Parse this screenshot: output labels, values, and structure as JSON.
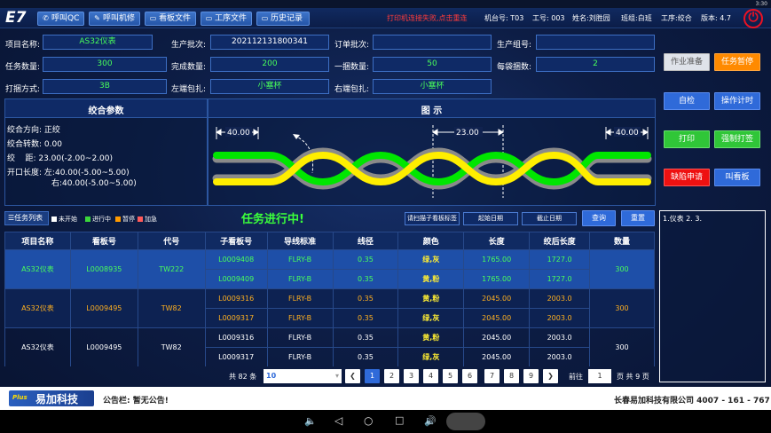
{
  "status_bar": {
    "time": "3:30"
  },
  "app": {
    "logo": "E7"
  },
  "nav": [
    {
      "label": "呼叫QC",
      "icon": "phone-icon"
    },
    {
      "label": "呼叫机修",
      "icon": "wrench-icon"
    },
    {
      "label": "看板文件",
      "icon": "folder-icon"
    },
    {
      "label": "工序文件",
      "icon": "folder-icon"
    },
    {
      "label": "历史记录",
      "icon": "folder-icon"
    }
  ],
  "header": {
    "warning": "打印机连接失败,点击重连",
    "machine_label": "机台号:",
    "machine": "T03",
    "worker_label": "工号:",
    "worker": "003",
    "name_label": "姓名:",
    "name": "刘胜园",
    "team_label": "班组:",
    "team": "白班",
    "process_label": "工序:",
    "process": "绞合",
    "version_label": "版本:",
    "version": "4.7"
  },
  "form": {
    "project_name_label": "项目名称:",
    "project_name": "AS32仪表",
    "prod_batch_label": "生产批次:",
    "prod_batch": "202112131800341",
    "order_batch_label": "订单批次:",
    "order_batch": "",
    "prod_group_label": "生产组号:",
    "prod_group": "",
    "task_qty_label": "任务数量:",
    "task_qty": "300",
    "done_qty_label": "完成数量:",
    "done_qty": "200",
    "bundle_qty_label": "一捆数量:",
    "bundle_qty": "50",
    "per_bag_label": "每袋捆数:",
    "per_bag": "2",
    "bind_mode_label": "打捆方式:",
    "bind_mode": "3B",
    "left_wrap_label": "左端包扎:",
    "left_wrap": "小塞杯",
    "right_wrap_label": "右端包扎:",
    "right_wrap": "小塞杯"
  },
  "actions": {
    "prepare": "作业准备",
    "pause": "任务暂停",
    "self_check": "自检",
    "op_timer": "操作计时",
    "print": "打印",
    "force_print": "强制打签",
    "defect": "缺陷申请",
    "call_board": "叫看板"
  },
  "twist_params": {
    "title": "绞合参数",
    "direction_label": "绞合方向:",
    "direction": "正绞",
    "turns_label": "绞合转数:",
    "turns": "0.00",
    "pitch_label": "绞    距:",
    "pitch": "23.00(-2.00~2.00)",
    "open_label": "开口长度:",
    "open_left_label": "左:",
    "open_left": "40.00(-5.00~5.00)",
    "open_right_label": "右:",
    "open_right": "40.00(-5.00~5.00)"
  },
  "diagram": {
    "title": "图 示",
    "left_dim": "40.00",
    "mid_dim": "23.00",
    "right_dim": "40.00",
    "colors": {
      "yellow": "#ffee00",
      "green": "#00e600",
      "gray": "#8a8a8a"
    }
  },
  "tasks": {
    "tab_label": "任务列表",
    "legend": [
      {
        "label": "未开始",
        "color": "#ffffff"
      },
      {
        "label": "进行中",
        "color": "#3bd63b"
      },
      {
        "label": "暂停",
        "color": "#ff9a00"
      },
      {
        "label": "加急",
        "color": "#ff5a5a"
      }
    ],
    "status": "任务进行中!",
    "scan_btn": "请扫描子看板标签",
    "start_date": "起始日期",
    "end_date": "截止日期",
    "query": "查询",
    "reset": "重置",
    "note": "1.仪表 2. 3.",
    "columns": [
      "项目名称",
      "看板号",
      "代号",
      "子看板号",
      "导线标准",
      "线径",
      "颜色",
      "长度",
      "绞后长度",
      "数量"
    ],
    "groups": [
      {
        "project": "AS32仪表",
        "board": "L0008935",
        "code": "TW222",
        "qty": "300",
        "style": "sel",
        "rows": [
          {
            "sub": "L0009408",
            "std": "FLRY-B",
            "dia": "0.35",
            "color": "绿,灰",
            "len": "1765.00",
            "after": "1727.0"
          },
          {
            "sub": "L0009409",
            "std": "FLRY-B",
            "dia": "0.35",
            "color": "黄,粉",
            "len": "1765.00",
            "after": "1727.0"
          }
        ]
      },
      {
        "project": "AS32仪表",
        "board": "L0009495",
        "code": "TW82",
        "qty": "300",
        "style": "orange",
        "rows": [
          {
            "sub": "L0009316",
            "std": "FLRY-B",
            "dia": "0.35",
            "color": "黄,粉",
            "len": "2045.00",
            "after": "2003.0"
          },
          {
            "sub": "L0009317",
            "std": "FLRY-B",
            "dia": "0.35",
            "color": "绿,灰",
            "len": "2045.00",
            "after": "2003.0"
          }
        ]
      },
      {
        "project": "AS32仪表",
        "board": "L0009495",
        "code": "TW82",
        "qty": "300",
        "style": "white",
        "rows": [
          {
            "sub": "L0009316",
            "std": "FLRY-B",
            "dia": "0.35",
            "color": "黄,粉",
            "len": "2045.00",
            "after": "2003.0"
          },
          {
            "sub": "L0009317",
            "std": "FLRY-B",
            "dia": "0.35",
            "color": "绿,灰",
            "len": "2045.00",
            "after": "2003.0"
          }
        ]
      }
    ]
  },
  "pagination": {
    "total": "共 82 条",
    "page_size": "10",
    "pages": [
      "1",
      "2",
      "3",
      "4",
      "5",
      "6",
      "7",
      "8",
      "9"
    ],
    "current": "1",
    "goto_label": "前往",
    "goto_value": "1",
    "pages_total": "页 共 9 页"
  },
  "footer": {
    "logo_text": "易加科技",
    "logo_sub": "Plus",
    "notice": "公告栏: 暂无公告!",
    "company": "长春易加科技有限公司 4007 - 161 - 767"
  }
}
